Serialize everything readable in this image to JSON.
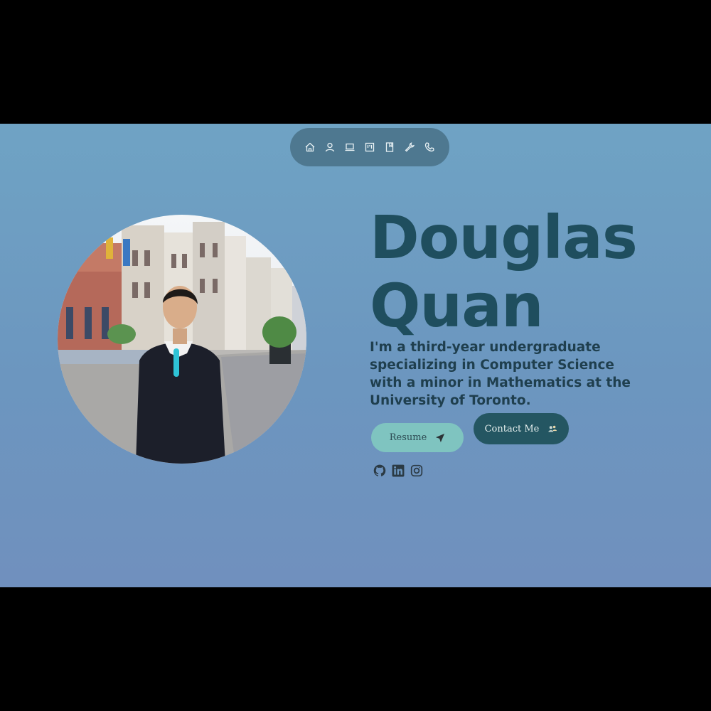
{
  "nav": {
    "items": [
      {
        "icon": "home-icon"
      },
      {
        "icon": "user-icon"
      },
      {
        "icon": "laptop-icon"
      },
      {
        "icon": "kanban-icon"
      },
      {
        "icon": "bookmark-icon"
      },
      {
        "icon": "wrench-icon"
      },
      {
        "icon": "phone-icon"
      }
    ]
  },
  "hero": {
    "name_line1": "Douglas",
    "name_line2": "Quan",
    "bio": "I'm a third-year undergraduate specializing in Computer Science with a minor in Mathematics at the University of Toronto.",
    "resume_label": "Resume",
    "contact_label": "Contact Me"
  },
  "social": [
    {
      "icon": "github-icon"
    },
    {
      "icon": "linkedin-icon"
    },
    {
      "icon": "instagram-icon"
    }
  ],
  "colors": {
    "background": "#6c9cc2",
    "nav_background": "#4e7890",
    "heading": "#1f4e5e",
    "resume_button": "#7fc4c0",
    "contact_button": "#245662"
  }
}
